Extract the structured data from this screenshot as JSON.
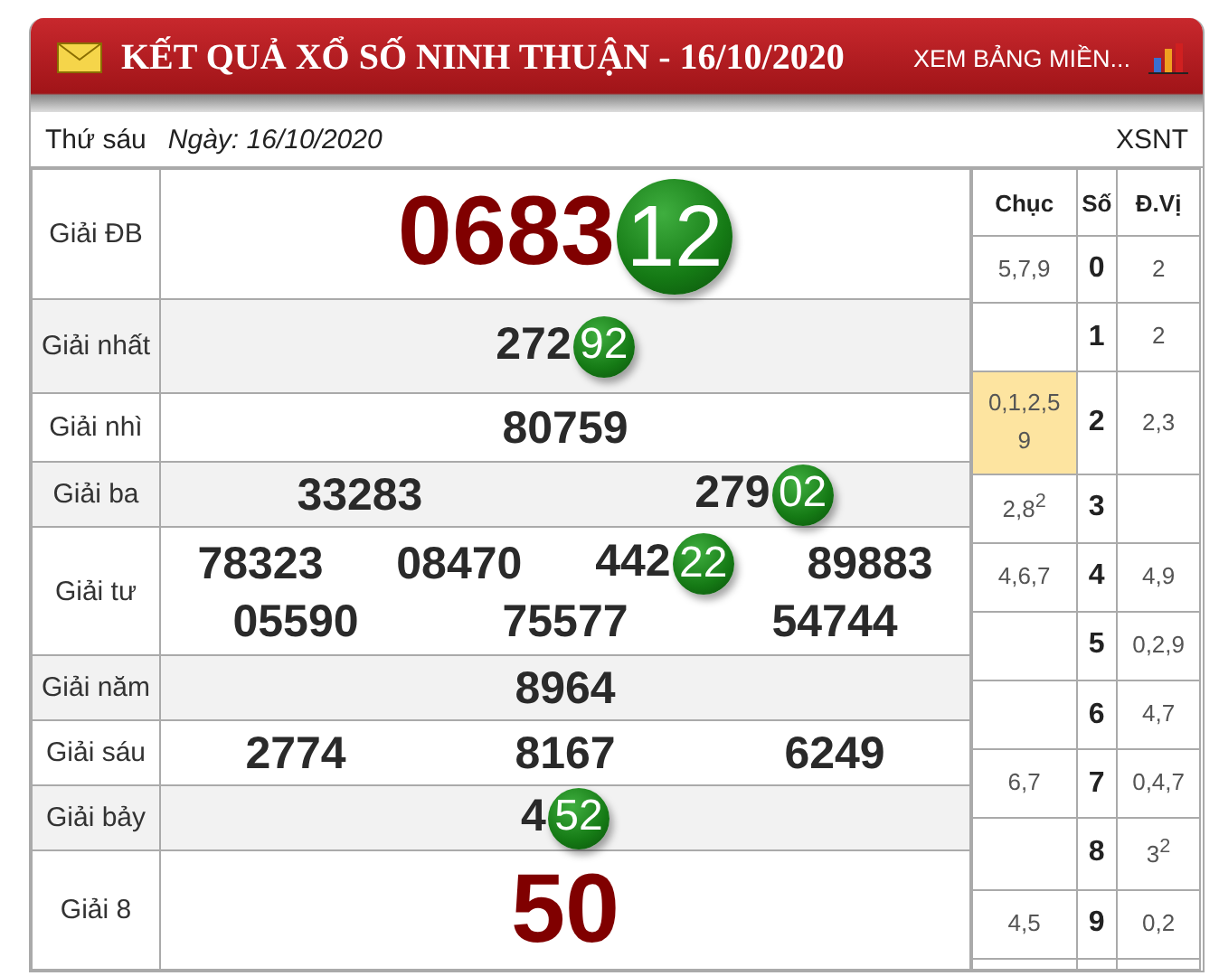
{
  "header": {
    "title": "KẾT QUẢ XỔ SỐ NINH THUẬN - 16/10/2020",
    "link": "XEM BẢNG MIỀN..."
  },
  "info": {
    "weekday": "Thứ sáu",
    "date": "Ngày: 16/10/2020",
    "code": "XSNT"
  },
  "prizes": [
    {
      "label": "Giải ĐB",
      "kind": "special",
      "lines": [
        [
          {
            "digits": "0683",
            "ball": "12"
          }
        ]
      ]
    },
    {
      "label": "Giải nhất",
      "kind": "normal",
      "lines": [
        [
          {
            "digits": "272",
            "ball": "92"
          }
        ]
      ]
    },
    {
      "label": "Giải nhì",
      "kind": "normal",
      "lines": [
        [
          {
            "digits": "80759"
          }
        ]
      ]
    },
    {
      "label": "Giải ba",
      "kind": "normal",
      "lines": [
        [
          {
            "digits": "33283"
          },
          {
            "digits": "279",
            "ball": "02"
          }
        ]
      ]
    },
    {
      "label": "Giải tư",
      "kind": "normal",
      "lines": [
        [
          {
            "digits": "78323"
          },
          {
            "digits": "08470"
          },
          {
            "digits": "442",
            "ball": "22"
          },
          {
            "digits": "89883"
          }
        ],
        [
          {
            "digits": "05590"
          },
          {
            "digits": "75577"
          },
          {
            "digits": "54744"
          }
        ]
      ]
    },
    {
      "label": "Giải năm",
      "kind": "normal",
      "lines": [
        [
          {
            "digits": "8964"
          }
        ]
      ]
    },
    {
      "label": "Giải sáu",
      "kind": "normal",
      "lines": [
        [
          {
            "digits": "2774"
          },
          {
            "digits": "8167"
          },
          {
            "digits": "6249"
          }
        ]
      ]
    },
    {
      "label": "Giải bảy",
      "kind": "normal",
      "lines": [
        [
          {
            "digits": "4",
            "ball": "52"
          }
        ]
      ]
    },
    {
      "label": "Giải 8",
      "kind": "special",
      "lines": [
        [
          {
            "digits": "50"
          }
        ]
      ]
    }
  ],
  "loto": {
    "columns": [
      "Chục",
      "Số",
      "Đ.Vị"
    ],
    "rows": [
      {
        "tens": "5,7,9",
        "digit": "0",
        "units": "2",
        "highlighted": false
      },
      {
        "digit": "1",
        "units": "2",
        "highlighted": false
      },
      {
        "tens": "0,1,2,5 9",
        "digit": "2",
        "units": "2,3",
        "highlighted": true
      },
      {
        "tens": "2,8$^{2}$",
        "digit": "3",
        "highlighted": false
      },
      {
        "tens": "4,6,7",
        "digit": "4",
        "units": "4,9",
        "highlighted": false
      },
      {
        "digit": "5",
        "units": "0,2,9",
        "highlighted": false
      },
      {
        "digit": "6",
        "units": "4,7",
        "highlighted": false
      },
      {
        "tens": "6,7",
        "digit": "7",
        "units": "0,4,7",
        "highlighted": false
      },
      {
        "digit": "8",
        "units": "3$^{2}$",
        "highlighted": false
      },
      {
        "tens": "4,5",
        "digit": "9",
        "units": "0,2",
        "highlighted": false
      }
    ]
  }
}
